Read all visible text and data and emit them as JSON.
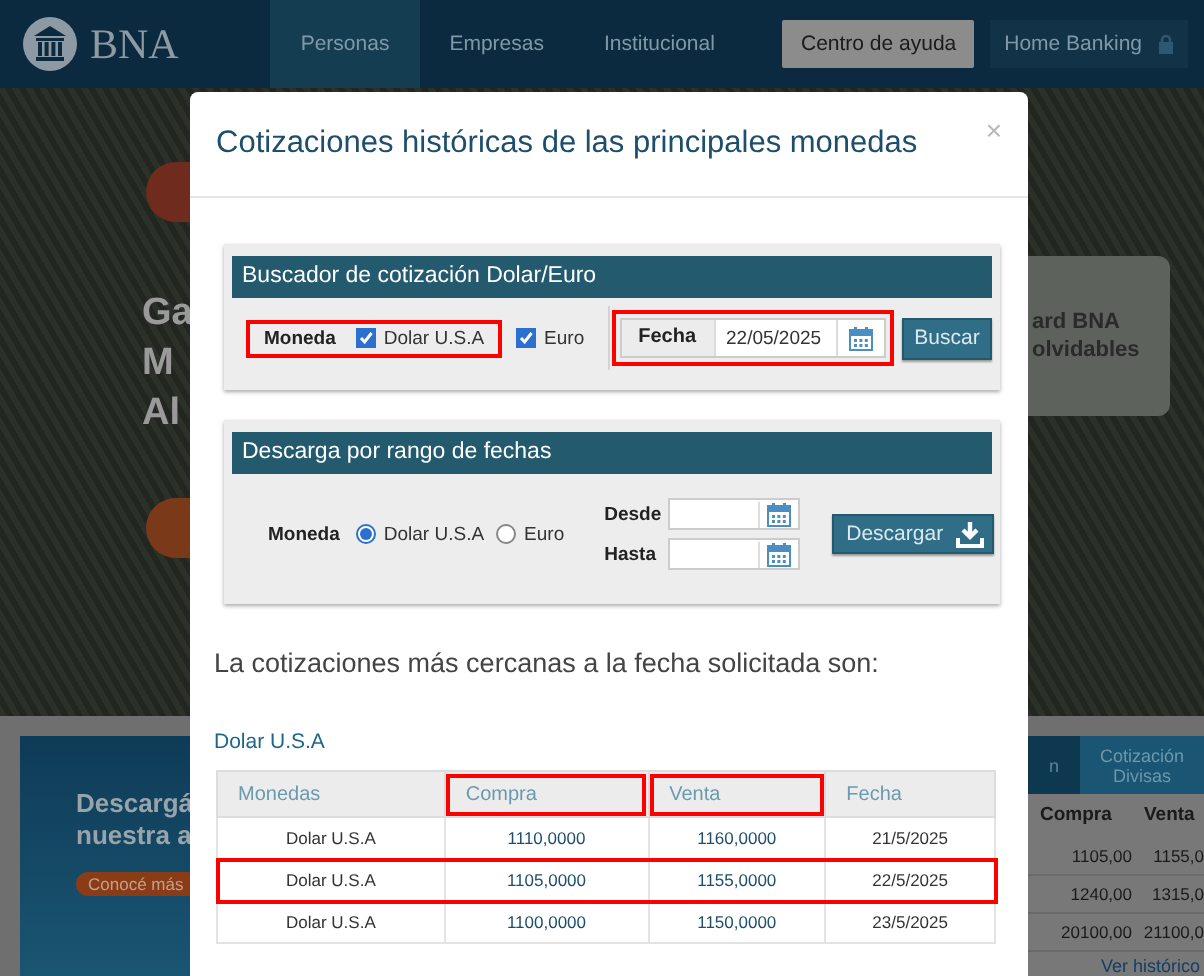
{
  "header": {
    "logo_text": "BNA",
    "nav": [
      {
        "label": "Personas",
        "selected": true
      },
      {
        "label": "Empresas",
        "selected": false
      },
      {
        "label": "Institucional",
        "selected": false
      }
    ],
    "help_button": "Centro de ayuda",
    "home_banking_button": "Home Banking"
  },
  "background": {
    "hero_lines": [
      "Ga",
      "M",
      "Al"
    ],
    "hero_card_lines": [
      "ard BNA",
      "olvidables"
    ],
    "promo": {
      "lines": [
        "Descargá",
        "nuestra a"
      ],
      "button": "Conocé más"
    },
    "rates_widget": {
      "tabs": [
        {
          "label": "n",
          "selected": false
        },
        {
          "label": "Cotización Divisas",
          "selected": true
        }
      ],
      "columns": [
        "Compra",
        "Venta"
      ],
      "rows": [
        [
          "1105,00",
          "1155,0"
        ],
        [
          "1240,00",
          "1315,0"
        ],
        [
          "20100,00",
          "21100,0"
        ]
      ],
      "link": "Ver histórico"
    }
  },
  "modal": {
    "title": "Cotizaciones históricas de las principales monedas",
    "close": "×",
    "search_panel": {
      "title": "Buscador de cotización Dolar/Euro",
      "currency_label": "Moneda",
      "options": [
        {
          "label": "Dolar U.S.A",
          "checked": true,
          "highlighted": true
        },
        {
          "label": "Euro",
          "checked": true,
          "highlighted": false
        }
      ],
      "date_label": "Fecha",
      "date_value": "22/05/2025",
      "date_highlighted": true,
      "button": "Buscar"
    },
    "download_panel": {
      "title": "Descarga por rango de fechas",
      "currency_label": "Moneda",
      "options": [
        {
          "label": "Dolar U.S.A",
          "selected": true
        },
        {
          "label": "Euro",
          "selected": false
        }
      ],
      "from_label": "Desde",
      "to_label": "Hasta",
      "button": "Descargar"
    },
    "result_text": "La cotizaciones más cercanas a la fecha solicitada son:",
    "table": {
      "caption": "Dolar U.S.A",
      "columns": [
        {
          "label": "Monedas",
          "highlighted": false
        },
        {
          "label": "Compra",
          "highlighted": true
        },
        {
          "label": "Venta",
          "highlighted": true
        },
        {
          "label": "Fecha",
          "highlighted": false
        }
      ],
      "rows": [
        {
          "cells": [
            "Dolar U.S.A",
            "1110,0000",
            "1160,0000",
            "21/5/2025"
          ],
          "highlighted": false
        },
        {
          "cells": [
            "Dolar U.S.A",
            "1105,0000",
            "1155,0000",
            "22/5/2025"
          ],
          "highlighted": true
        },
        {
          "cells": [
            "Dolar U.S.A",
            "1100,0000",
            "1150,0000",
            "23/5/2025"
          ],
          "highlighted": false
        }
      ]
    }
  }
}
